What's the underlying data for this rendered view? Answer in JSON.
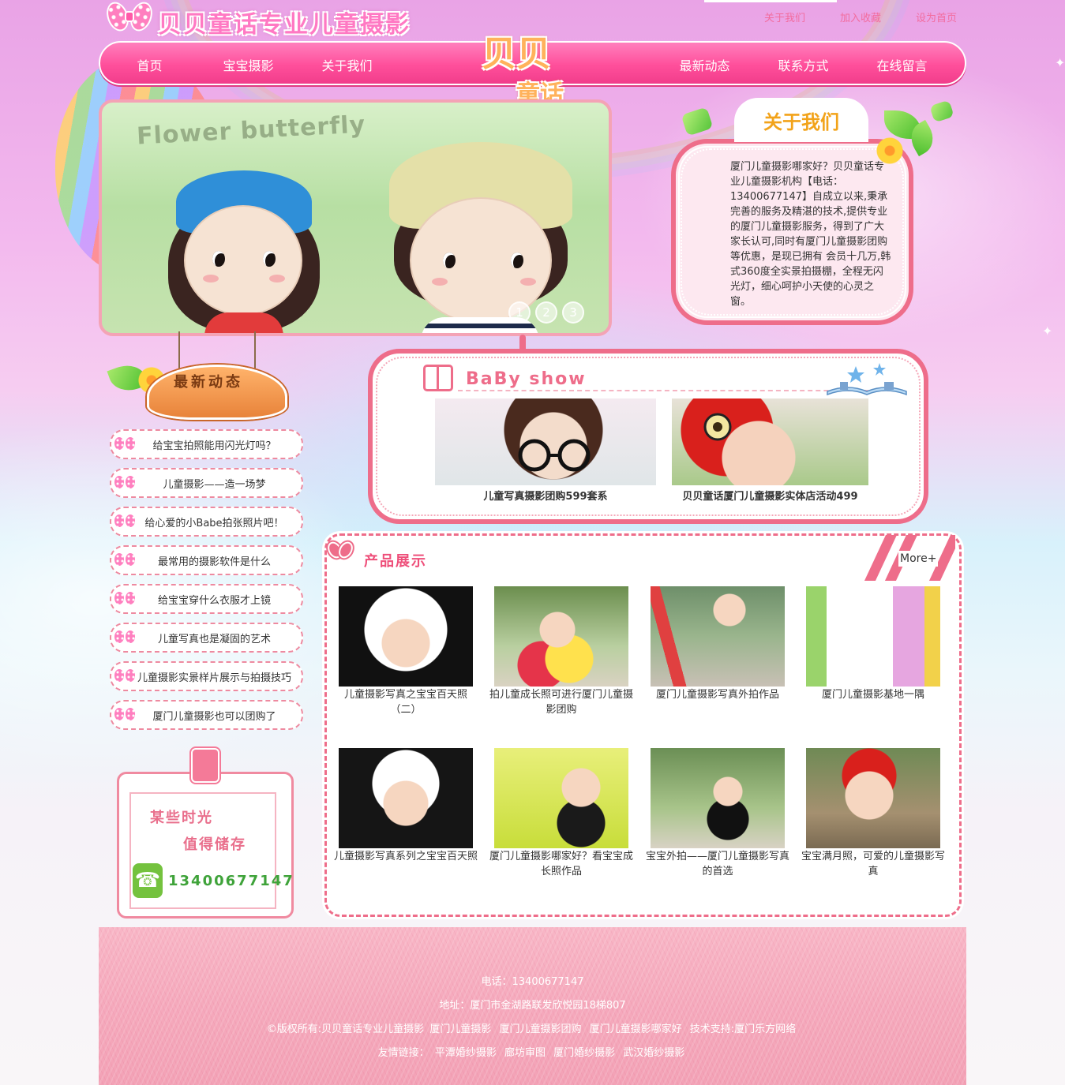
{
  "header": {
    "logo_text": "贝贝童话专业儿童摄影",
    "top_links": [
      "关于我们",
      "加入收藏",
      "设为首页"
    ],
    "center_logo_line1": "贝贝",
    "center_logo_line2": "童话"
  },
  "nav": {
    "left": [
      "首页",
      "宝宝摄影",
      "关于我们"
    ],
    "right": [
      "最新动态",
      "联系方式",
      "在线留言"
    ]
  },
  "banner": {
    "background_words": "Flower butterfly",
    "dots": [
      "1",
      "2",
      "3"
    ]
  },
  "about": {
    "title": "关于我们",
    "text": "厦门儿童摄影哪家好？贝贝童话专业儿童摄影机构【电话：13400677147】自成立以来,秉承完善的服务及精湛的技术,提供专业的厦门儿童摄影服务，得到了广大家长认可,同时有厦门儿童摄影团购等优惠，是现已拥有 会员十几万,韩式360度全实景拍摄棚，全程无闪光灯，细心呵护小天使的心灵之窗。"
  },
  "news": {
    "title": "最新动态",
    "items": [
      "给宝宝拍照能用闪光灯吗？",
      "儿童摄影——造一场梦",
      "给心爱的小Babe拍张照片吧！",
      "最常用的摄影软件是什么",
      "给宝宝穿什么衣服才上镜",
      "儿童写真也是凝固的艺术",
      "儿童摄影实景样片展示与拍摄技巧",
      "厦门儿童摄影也可以团购了"
    ]
  },
  "memo": {
    "line1": "某些时光",
    "line2": "值得储存",
    "phone": "13400677147"
  },
  "baby_show": {
    "title": "BaBy show",
    "cards": [
      {
        "caption": "儿童写真摄影团购599套系"
      },
      {
        "caption": "贝贝童话厦门儿童摄影实体店活动499"
      }
    ]
  },
  "products": {
    "title": "产品展示",
    "more": "More+",
    "items": [
      {
        "caption": "儿童摄影写真之宝宝百天照（二）"
      },
      {
        "caption": "拍儿童成长照可进行厦门儿童摄影团购"
      },
      {
        "caption": "厦门儿童摄影写真外拍作品"
      },
      {
        "caption": "厦门儿童摄影基地一隅"
      },
      {
        "caption": "儿童摄影写真系列之宝宝百天照"
      },
      {
        "caption": "厦门儿童摄影哪家好？看宝宝成长照作品"
      },
      {
        "caption": "宝宝外拍——厦门儿童摄影写真的首选"
      },
      {
        "caption": "宝宝满月照，可爱的儿童摄影写真"
      }
    ]
  },
  "footer": {
    "phone": "电话：13400677147",
    "address": "地址：厦门市金湖路联发欣悦园18梯807",
    "copyright_prefix": "©版权所有:贝贝童话专业儿童摄影",
    "copyright_links": [
      "厦门儿童摄影",
      "厦门儿童摄影团购",
      "厦门儿童摄影哪家好"
    ],
    "tech_support": "技术支持:厦门乐方网络",
    "friend_label": "友情链接：",
    "friend_links": [
      "平潭婚纱摄影",
      "廊坊审图",
      "厦门婚纱摄影",
      "武汉婚纱摄影"
    ]
  },
  "colors": {
    "nav_pink": "#ff4f9b",
    "frame_pink": "#ee6d8a",
    "orange": "#f2a31a",
    "footer_pink": "#f5a9bc"
  }
}
